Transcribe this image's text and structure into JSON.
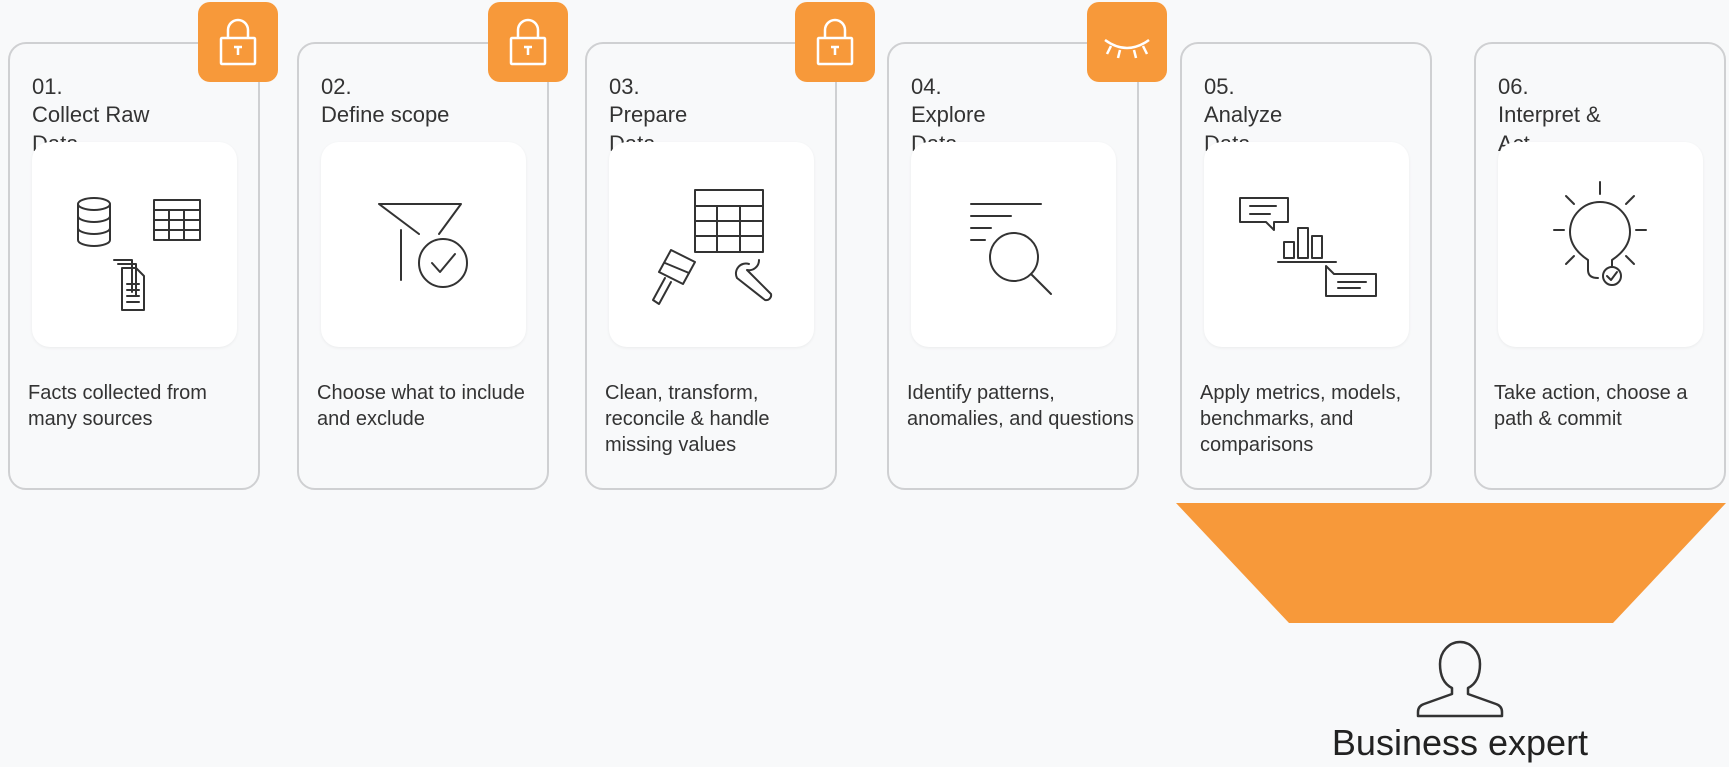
{
  "steps": [
    {
      "num": "01.",
      "title": "Collect Raw\nData",
      "desc": "Facts collected from many sources",
      "icon": "database-table-documents-icon",
      "badge": "lock-icon"
    },
    {
      "num": "02.",
      "title": "Define scope",
      "desc": "Choose what to include and exclude",
      "icon": "filter-check-icon",
      "badge": "lock-icon"
    },
    {
      "num": "03.",
      "title": "Prepare\nData",
      "desc": "Clean, transform, reconcile & handle missing values",
      "icon": "table-brush-wrench-icon",
      "badge": "lock-icon"
    },
    {
      "num": "04.",
      "title": "Explore\nData",
      "desc": "Identify patterns, anomalies, and questions",
      "icon": "magnifier-lines-icon",
      "badge": "closed-eye-icon"
    },
    {
      "num": "05.",
      "title": "Analyze\nData",
      "desc": "Apply metrics, models, benchmarks, and comparisons",
      "icon": "chart-comments-icon",
      "badge": ""
    },
    {
      "num": "06.",
      "title": "Interpret &\nAct",
      "desc": "Take action, choose a path & commit",
      "icon": "lightbulb-check-icon",
      "badge": ""
    }
  ],
  "expert": {
    "label": "Business expert",
    "icon": "person-icon"
  },
  "colors": {
    "accent": "#f7993a",
    "card_border": "#cfd0d2",
    "icon_bg": "#ffffff",
    "background": "#f8f9fa"
  }
}
